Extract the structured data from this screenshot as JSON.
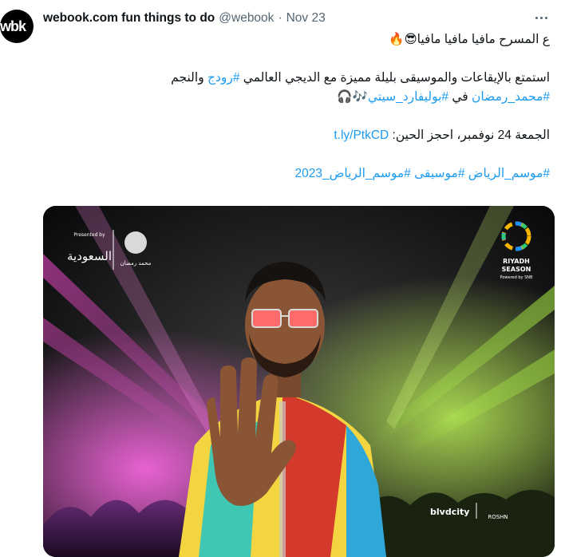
{
  "author": {
    "avatar_text": "wbk",
    "name": "webook.com fun things to do",
    "handle": "@webook",
    "separator": "·",
    "date": "Nov 23"
  },
  "tweet": {
    "line1": "ع المسرح مافيا مافيا مافيا😎🔥",
    "line2_text": "استمتع بالإيقاعات والموسيقى بليلة مميزة مع الديجي العالمي ",
    "line2_tag1": "#رودج",
    "line2_mid": " والنجم",
    "line3_tag1": "#محمد_رمضان",
    "line3_mid": " في ",
    "line3_tag2": "#بوليفارد_سيتي",
    "line3_emoji": "🎶🎧",
    "line4_text": "الجمعة 24 نوفمبر، احجز الحين: ",
    "line4_link": "t.ly/PtkCD",
    "hashtags": [
      "#موسم_الرياض",
      "#موسيقى",
      "#موسم_الرياض_2023"
    ]
  },
  "media": {
    "presented_by": "Presented by",
    "sponsor_left": "السعودية",
    "artist_logo": "محمد رمضان",
    "season_line1": "RIYADH",
    "season_line2": "SEASON",
    "season_powered": "Powered by SNB",
    "venue": "blvdcity",
    "developer": "ROSHN"
  },
  "colors": {
    "link": "#1d9bf0",
    "text": "#0f1419",
    "muted": "#536471"
  }
}
